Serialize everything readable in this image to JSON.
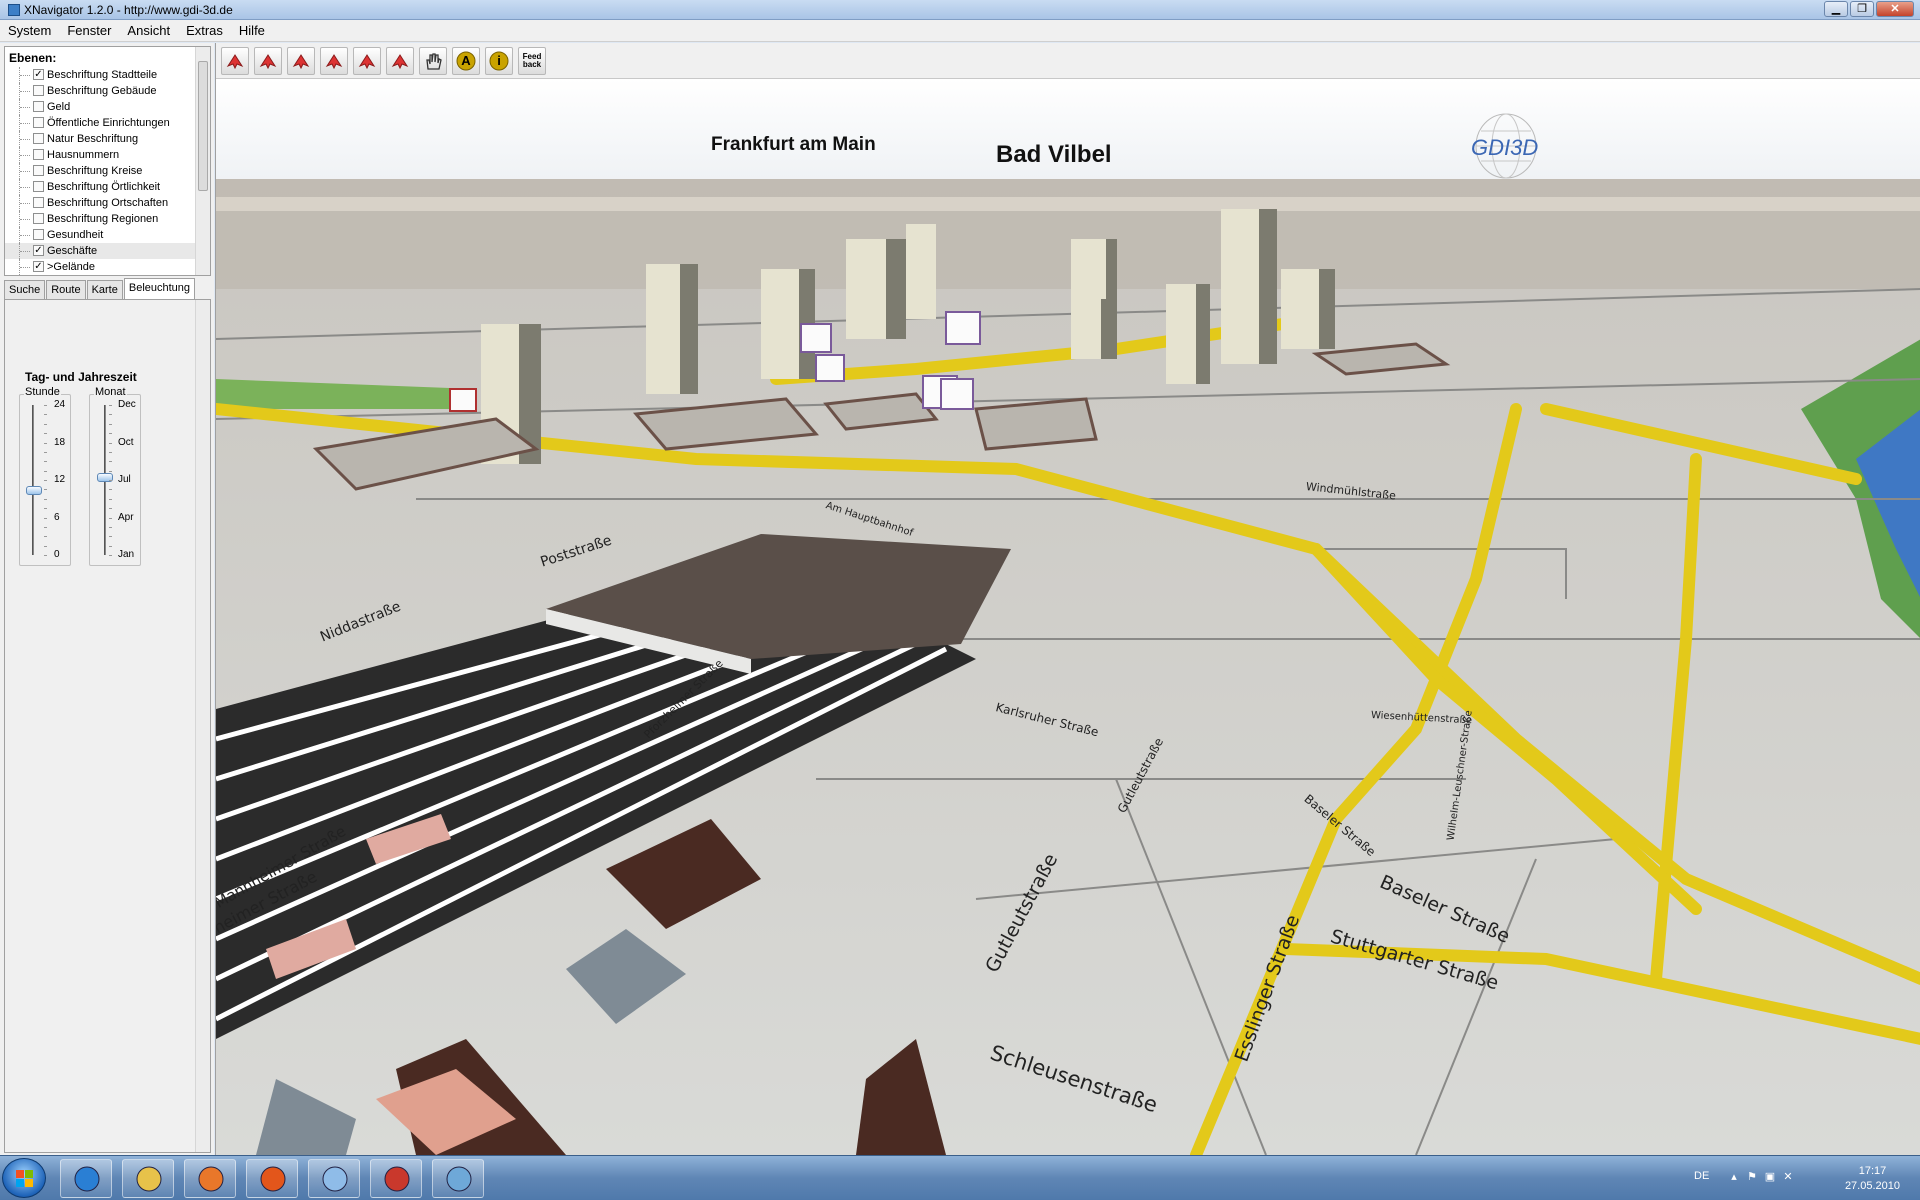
{
  "window": {
    "title": "XNavigator 1.2.0 - http://www.gdi-3d.de",
    "min": "▁",
    "max": "❐",
    "close": "✕"
  },
  "menu": [
    "System",
    "Fenster",
    "Ansicht",
    "Extras",
    "Hilfe"
  ],
  "layers": {
    "header": "Ebenen:",
    "items": [
      {
        "label": "Beschriftung Stadtteile",
        "check": "✓"
      },
      {
        "label": "Beschriftung Gebäude",
        "check": ""
      },
      {
        "label": "Geld",
        "check": ""
      },
      {
        "label": "Öffentliche Einrichtungen",
        "check": ""
      },
      {
        "label": "Natur Beschriftung",
        "check": ""
      },
      {
        "label": "Hausnummern",
        "check": ""
      },
      {
        "label": "Beschriftung Kreise",
        "check": ""
      },
      {
        "label": "Beschriftung Örtlichkeit",
        "check": ""
      },
      {
        "label": "Beschriftung Ortschaften",
        "check": ""
      },
      {
        "label": "Beschriftung Regionen",
        "check": ""
      },
      {
        "label": "Gesundheit",
        "check": ""
      },
      {
        "label": "Geschäfte",
        "check": "✓"
      },
      {
        "label": ">Gelände",
        "check": "✓"
      }
    ]
  },
  "tabs": [
    "Suche",
    "Route",
    "Karte",
    "Beleuchtung"
  ],
  "active_tab": "Beleuchtung",
  "lighting": {
    "title": "Tag- und Jahreszeit",
    "hour": {
      "label": "Stunde",
      "ticks": [
        "24",
        "18",
        "12",
        "6",
        "0"
      ],
      "value": 11
    },
    "month": {
      "label": "Monat",
      "ticks": [
        "Dec",
        "Oct",
        "Jul",
        "Apr",
        "Jan"
      ],
      "value": "Jul"
    }
  },
  "toolbar": {
    "tools": [
      {
        "name": "pan-red-icon",
        "color": "#d33"
      },
      {
        "name": "rotate-red-icon",
        "color": "#d33"
      },
      {
        "name": "move-up-down-icon",
        "color": "#d33"
      },
      {
        "name": "move-cross-icon",
        "color": "#d33"
      },
      {
        "name": "refresh-icon",
        "color": "#d33"
      },
      {
        "name": "back-icon",
        "color": "#d33"
      },
      {
        "name": "hand-icon",
        "color": "#444"
      },
      {
        "name": "annotation-icon",
        "color": "#c9a300"
      },
      {
        "name": "info-icon",
        "color": "#c9a300"
      },
      {
        "name": "feedback-icon",
        "color": "#444"
      }
    ],
    "tool_letters": {
      "annotation": "A",
      "info": "i"
    },
    "feedback_label": "Feed back"
  },
  "map": {
    "cities": [
      {
        "name": "Frankfurt am Main"
      },
      {
        "name": "Bad Vilbel"
      }
    ],
    "logo": "GDI3D",
    "streets": [
      "Baseler Straße",
      "Stuttgarter Straße",
      "Gutleutstraße",
      "Schleusenstraße",
      "Esslinger Straße",
      "Mannheimer Straße",
      "Pforzheimer Straße",
      "Karlsruher Straße",
      "Niddastraße",
      "Poststraße",
      "Wiesenhüttenstraße",
      "Wilhelm-Leuschner-Straße",
      "Windmühlstraße",
      "Baseler Straße",
      "Am Hauptbahnhof",
      "Gutleutstraße",
      "Mannheimer Straße"
    ]
  },
  "taskbar": {
    "lang": "DE",
    "time": "17:17",
    "date": "27.05.2010",
    "apps": [
      "ie-icon",
      "explorer-icon",
      "media-player-icon",
      "firefox-icon",
      "paint-icon",
      "java-icon",
      "notepad-icon"
    ]
  }
}
